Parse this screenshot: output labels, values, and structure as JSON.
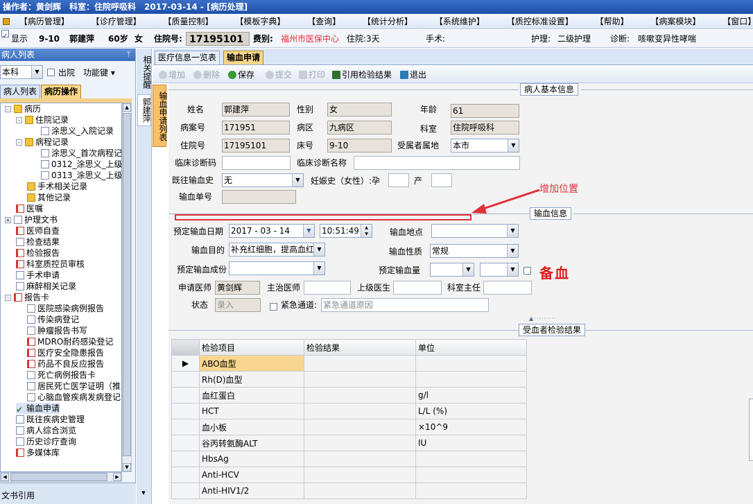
{
  "titlebar": {
    "text": "操作者：黄剑辉　科室：住院呼吸科　2017-03-14 - [病历处理]"
  },
  "menu": [
    "【病历管理】",
    "【诊疗管理】",
    "【质量控制】",
    "【模板字典】",
    "【查询】",
    "【统计分析】",
    "【系统维护】",
    "【质控标准设置】",
    "【帮助】",
    "【病案模块】",
    "【窗口】"
  ],
  "patient_bar": {
    "show_label": "显示",
    "bed": "9-10",
    "name": "郭建萍",
    "age": "60岁",
    "sex": "女",
    "inpatient_no_label": "住院号:",
    "inpatient_no": "17195101",
    "fee_label": "费别:",
    "fee": "福州市医保中心",
    "days": "住院:3天",
    "surgery_label": "手术:",
    "nursing_label": "护理:",
    "nursing": "二级护理",
    "diagnosis_label": "诊断:",
    "diagnosis": "咳嗽变异性哮喘"
  },
  "left_panel": {
    "header": "病人列表",
    "dept": "本科",
    "discharged": "出院",
    "func_key": "功能键",
    "tabs": [
      "病人列表",
      "病历操作"
    ],
    "tree": [
      {
        "label": "病历",
        "icon": "folder-icon"
      },
      {
        "label": "住院记录",
        "icon": "folder-icon"
      },
      {
        "label": "涂思义_入院记录",
        "icon": "document-icon"
      },
      {
        "label": "病程记录",
        "icon": "folder-icon"
      },
      {
        "label": "涂思义_首次病程记",
        "icon": "document-icon"
      },
      {
        "label": "0312_涂思义_上级",
        "icon": "document-icon"
      },
      {
        "label": "0313_涂思义_上级",
        "icon": "document-icon"
      },
      {
        "label": "手术相关记录",
        "icon": "folder-icon"
      },
      {
        "label": "其他记录",
        "icon": "folder-icon"
      },
      {
        "label": "医嘱",
        "icon": "orders-icon"
      },
      {
        "label": "护理文书",
        "icon": "document-icon"
      },
      {
        "label": "医师自查",
        "icon": "document-icon"
      },
      {
        "label": "检查结果",
        "icon": "document-icon"
      },
      {
        "label": "检验报告",
        "icon": "document-icon"
      },
      {
        "label": "科室质控员审核",
        "icon": "document-icon"
      },
      {
        "label": "手术申请",
        "icon": "document-icon"
      },
      {
        "label": "麻醉相关记录",
        "icon": "document-icon"
      },
      {
        "label": "报告卡",
        "icon": "document-icon"
      },
      {
        "label": "医院感染病例报告",
        "icon": "document-icon"
      },
      {
        "label": "传染病登记",
        "icon": "document-icon"
      },
      {
        "label": "肿瘤报告书写",
        "icon": "document-icon"
      },
      {
        "label": "MDRO耐药感染登记",
        "icon": "document-icon"
      },
      {
        "label": "医疗安全隐患报告",
        "icon": "document-icon"
      },
      {
        "label": "药品不良反应报告",
        "icon": "document-icon"
      },
      {
        "label": "死亡病例报告卡",
        "icon": "document-icon"
      },
      {
        "label": "居民死亡医学证明（推",
        "icon": "document-icon"
      },
      {
        "label": "心脑血管疾病发病登记",
        "icon": "document-icon"
      },
      {
        "label": "输血申请",
        "icon": "checkmark-icon"
      },
      {
        "label": "既往疾病史管理",
        "icon": "document-icon"
      },
      {
        "label": "病人综合浏览",
        "icon": "magnifier-icon"
      },
      {
        "label": "历史诊疗查询",
        "icon": "document-icon"
      },
      {
        "label": "多媒体库",
        "icon": "document-icon"
      }
    ],
    "bottom": "文书引用"
  },
  "vertical_tabs": {
    "related": "相关提醒",
    "patient": "郭建萍",
    "list": "输血申请列表"
  },
  "main_tabs": [
    "医疗信息一览表",
    "输血申请"
  ],
  "toolbar": {
    "add": "增加",
    "delete": "删除",
    "save": "保存",
    "submit": "提交",
    "print": "打印",
    "cite": "引用检验结果",
    "exit": "退出"
  },
  "basic_info": {
    "section": "病人基本信息",
    "name_label": "姓名",
    "name": "郭建萍",
    "sex_label": "性别",
    "sex": "女",
    "age_label": "年龄",
    "age": "61",
    "case_label": "病案号",
    "case_no": "171951",
    "ward_label": "病区",
    "ward": "九病区",
    "dept_label": "科室",
    "dept": "住院呼吸科",
    "inp_label": "住院号",
    "inp_no": "17195101",
    "bed_label": "床号",
    "bed": "9-10",
    "region_label": "受属者属地",
    "region": "本市",
    "diag_code_label": "临床诊断码",
    "diag_name_label": "临床诊断名称",
    "history_label": "既往输血史",
    "history": "无",
    "pregnancy_label": "妊娠史（女性）:孕",
    "birth_label": "产",
    "form_no_label": "输血单号"
  },
  "annotation": {
    "add_position": "增加位置",
    "standby": "备血"
  },
  "transfusion_info": {
    "section": "输血信息",
    "date_label": "预定输血日期",
    "date": "2017 - 03 - 14",
    "time": "10:51:49",
    "place_label": "输血地点",
    "purpose_label": "输血目的",
    "purpose": "补充红细胞，提高血红",
    "nature_label": "输血性质",
    "nature": "常规",
    "component_label": "预定输血成份",
    "amount_label": "预定输血量",
    "doctor_label": "申请医师",
    "doctor": "黄剑辉",
    "attending_label": "主治医师",
    "superior_label": "上级医生",
    "director_label": "科室主任",
    "status_label": "状态",
    "status": "录入",
    "emergency_label": "紧急通道:",
    "emergency_placeholder": "紧急通道原因"
  },
  "results": {
    "section": "受血者检验结果",
    "columns": [
      "检验项目",
      "检验结果",
      "单位"
    ],
    "rows": [
      {
        "item": "ABO血型",
        "result": "",
        "unit": ""
      },
      {
        "item": "Rh(D)血型",
        "result": "",
        "unit": ""
      },
      {
        "item": "血红蛋白",
        "result": "",
        "unit": "g/l"
      },
      {
        "item": "HCT",
        "result": "",
        "unit": "L/L (%)"
      },
      {
        "item": "血小板",
        "result": "",
        "unit": "×10^9"
      },
      {
        "item": "谷丙转氨酶ALT",
        "result": "",
        "unit": "IU"
      },
      {
        "item": "HbsAg",
        "result": "",
        "unit": ""
      },
      {
        "item": "Anti-HCV",
        "result": "",
        "unit": ""
      },
      {
        "item": "Anti-HIV1/2",
        "result": "",
        "unit": ""
      }
    ]
  },
  "colors": {
    "title": "#1c4fa8",
    "red": "#e0303a",
    "active_tab": "#f8d78a"
  }
}
